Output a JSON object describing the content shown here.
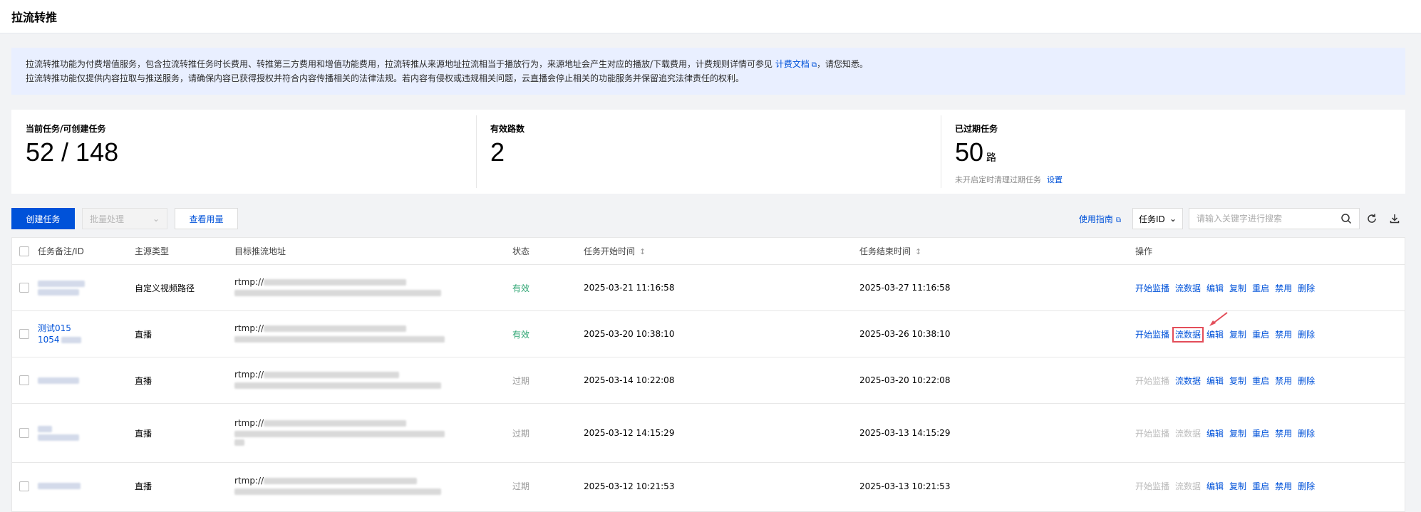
{
  "page": {
    "title": "拉流转推"
  },
  "notice": {
    "line1_before": "拉流转推功能为付费增值服务，包含拉流转推任务时长费用、转推第三方费用和增值功能费用，拉流转推从来源地址拉流相当于播放行为，来源地址会产生对应的播放/下载费用，计费规则详情可参见",
    "link": "计费文档",
    "line1_after": "，请您知悉。",
    "line2": "拉流转推功能仅提供内容拉取与推送服务，请确保内容已获得授权并符合内容传播相关的法律法规。若内容有侵权或违规相关问题，云直播会停止相关的功能服务并保留追究法律责任的权利。"
  },
  "stats": {
    "current": {
      "label": "当前任务/可创建任务",
      "value": "52 / 148"
    },
    "valid": {
      "label": "有效路数",
      "value": "2"
    },
    "expired": {
      "label": "已过期任务",
      "value": "50",
      "unit": "路",
      "sub": "未开启定时清理过期任务",
      "link": "设置"
    }
  },
  "toolbar": {
    "create": "创建任务",
    "batch": "批量处理",
    "usage": "查看用量",
    "guide": "使用指南",
    "id_select": "任务ID",
    "search_placeholder": "请输入关键字进行搜索"
  },
  "table": {
    "headers": {
      "id": "任务备注/ID",
      "type": "主源类型",
      "url": "目标推流地址",
      "status": "状态",
      "start": "任务开始时间",
      "end": "任务结束时间",
      "ops": "操作"
    },
    "rows": [
      {
        "id_line1": "",
        "id_line2": "",
        "type": "自定义视频路径",
        "url": "rtmp://",
        "status": "有效",
        "start": "2025-03-21 11:16:58",
        "end": "2025-03-27 11:16:58"
      },
      {
        "id_line1": "测试015",
        "id_line2": "1054",
        "type": "直播",
        "url": "rtmp://",
        "status": "有效",
        "start": "2025-03-20 10:38:10",
        "end": "2025-03-26 10:38:10"
      },
      {
        "id_line1": "",
        "id_line2": "",
        "type": "直播",
        "url": "rtmp://",
        "status": "过期",
        "start": "2025-03-14 10:22:08",
        "end": "2025-03-20 10:22:08"
      },
      {
        "id_line1": "",
        "id_line2": "",
        "type": "直播",
        "url": "rtmp://",
        "status": "过期",
        "start": "2025-03-12 14:15:29",
        "end": "2025-03-13 14:15:29"
      },
      {
        "id_line1": "",
        "id_line2": "",
        "type": "直播",
        "url": "rtmp://",
        "status": "过期",
        "start": "2025-03-12 10:21:53",
        "end": "2025-03-13 10:21:53"
      }
    ],
    "ops": {
      "monitor": "开始监播",
      "streamdata": "流数据",
      "edit": "编辑",
      "copy": "复制",
      "restart": "重启",
      "disable": "禁用",
      "delete": "删除"
    }
  },
  "colors": {
    "primary": "#0052d9",
    "valid": "#2ba471",
    "highlight": "#e34d59"
  }
}
